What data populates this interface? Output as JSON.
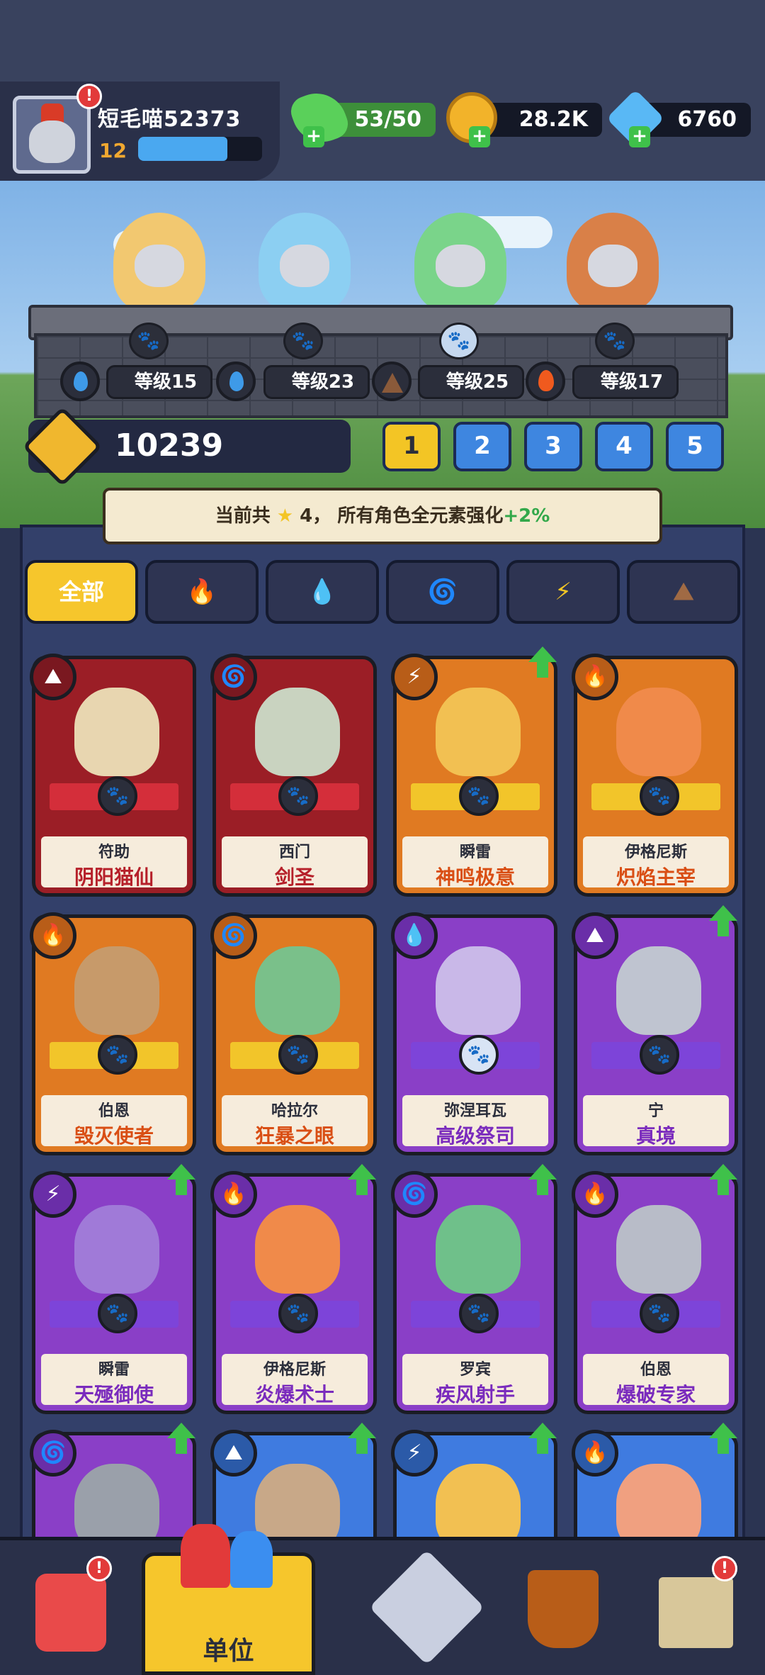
{
  "player": {
    "name": "短毛喵52373",
    "level": "12",
    "xp_fraction": 0.72
  },
  "resources": {
    "energy": "53/50",
    "coins": "28.2K",
    "gems": "6760"
  },
  "formation": {
    "heroes": [
      {
        "element": "water-icon",
        "level_label": "等级15"
      },
      {
        "element": "water-icon",
        "level_label": "等级23"
      },
      {
        "element": "earth-icon",
        "level_label": "等级25"
      },
      {
        "element": "fire-icon",
        "level_label": "等级17"
      }
    ],
    "power": "10239",
    "teams": [
      "1",
      "2",
      "3",
      "4",
      "5"
    ],
    "active_team": "1"
  },
  "banner": {
    "prefix": "当前共",
    "count": "4，",
    "suffix": "所有角色全元素强化",
    "bonus": "+2%"
  },
  "filters": [
    {
      "label": "全部",
      "icon": "",
      "active": true
    },
    {
      "label": "",
      "icon": "fire-icon",
      "active": false
    },
    {
      "label": "",
      "icon": "water-icon",
      "active": false
    },
    {
      "label": "",
      "icon": "wind-icon",
      "active": false
    },
    {
      "label": "",
      "icon": "lightning-icon",
      "active": false
    },
    {
      "label": "",
      "icon": "earth-icon",
      "active": false
    }
  ],
  "cards": [
    {
      "name": "符助",
      "title": "阴阳猫仙",
      "rarity": "red",
      "element": "earth-icon",
      "upgrade": false
    },
    {
      "name": "西门",
      "title": "剑圣",
      "rarity": "red",
      "element": "wind-icon",
      "upgrade": false
    },
    {
      "name": "瞬雷",
      "title": "神鸣极意",
      "rarity": "orange",
      "element": "lightning-icon",
      "upgrade": true
    },
    {
      "name": "伊格尼斯",
      "title": "炽焰主宰",
      "rarity": "orange",
      "element": "fire-icon",
      "upgrade": false
    },
    {
      "name": "伯恩",
      "title": "毁灭使者",
      "rarity": "orange",
      "element": "fire-icon",
      "upgrade": false
    },
    {
      "name": "哈拉尔",
      "title": "狂暴之眼",
      "rarity": "orange",
      "element": "wind-icon",
      "upgrade": false
    },
    {
      "name": "弥涅耳瓦",
      "title": "高级祭司",
      "rarity": "purple",
      "element": "water-icon",
      "upgrade": false
    },
    {
      "name": "宁",
      "title": "真境",
      "rarity": "purple",
      "element": "earth-icon",
      "upgrade": true
    },
    {
      "name": "瞬雷",
      "title": "天殛御使",
      "rarity": "purple",
      "element": "lightning-icon",
      "upgrade": true
    },
    {
      "name": "伊格尼斯",
      "title": "炎爆术士",
      "rarity": "purple",
      "element": "fire-icon",
      "upgrade": true
    },
    {
      "name": "罗宾",
      "title": "疾风射手",
      "rarity": "purple",
      "element": "wind-icon",
      "upgrade": true
    },
    {
      "name": "伯恩",
      "title": "爆破专家",
      "rarity": "purple",
      "element": "fire-icon",
      "upgrade": true
    },
    {
      "name": "",
      "title": "",
      "rarity": "purple",
      "element": "wind-icon",
      "upgrade": true
    },
    {
      "name": "",
      "title": "",
      "rarity": "blue",
      "element": "earth-icon",
      "upgrade": true
    },
    {
      "name": "",
      "title": "",
      "rarity": "blue",
      "element": "lightning-icon",
      "upgrade": true
    },
    {
      "name": "",
      "title": "",
      "rarity": "blue",
      "element": "fire-icon",
      "upgrade": true
    }
  ],
  "bottom_nav": {
    "items": [
      "home-icon",
      "units-icon",
      "battle-icon",
      "ship-icon",
      "map-icon"
    ],
    "active_label": "单位"
  }
}
